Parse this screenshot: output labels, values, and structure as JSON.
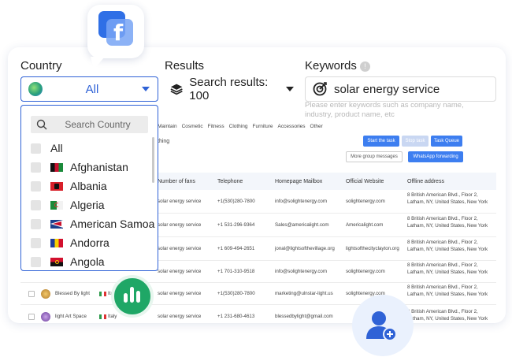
{
  "labels": {
    "country": "Country",
    "results": "Results",
    "keywords": "Keywords",
    "info": "!"
  },
  "country_select": {
    "value": "All"
  },
  "results_select": {
    "value": "Search results: 100"
  },
  "keywords_input": {
    "value": "solar energy service",
    "hint": "Please enter keywords such as company name, industry, product name, etc"
  },
  "categories": [
    "Maintain",
    "Cosmetic",
    "Fitness",
    "Clothing",
    "Furniture",
    "Accessories",
    "Other"
  ],
  "partial_label": "thing",
  "buttons": {
    "start_task": "Start the task",
    "stop_task": "Stop task",
    "task_queue": "Task Queue",
    "group_messages": "More group messages",
    "whatsapp": "WhatsApp forwarding"
  },
  "table": {
    "headers": [
      "Number of fans",
      "Telephone",
      "Homepage Mailbox",
      "Official Website",
      "Offline address"
    ],
    "rows": [
      {
        "fans": "solar energy service",
        "phone": "+1(530)280-7800",
        "mail": "info@solightenergy.com",
        "site": "solightenergy.com",
        "address": "8 British American Blvd., Floor 2, Latham, NY, United States, New York"
      },
      {
        "fans": "solar energy service",
        "phone": "+1 531-296-9364",
        "mail": "Sales@americalight.com",
        "site": "Americalight.com",
        "address": "8 British American Blvd., Floor 2, Latham, NY, United States, New York"
      },
      {
        "fans": "solar energy service",
        "phone": "+1 609-494-2651",
        "mail": "jonal@lightsofthevillage.org",
        "site": "lightsofthecityclayton.org",
        "address": "8 British American Blvd., Floor 2, Latham, NY, United States, New York"
      },
      {
        "fans": "solar energy service",
        "phone": "+1 701-310-9518",
        "mail": "info@solightenergy.com",
        "site": "solightenergy.com",
        "address": "8 British American Blvd., Floor 2, Latham, NY, United States, New York"
      },
      {
        "name": "Blessed By light",
        "country": "Italy",
        "fans": "solar energy service",
        "phone": "+1(530)280-7800",
        "mail": "marketing@ulnstar-light.us",
        "site": "solightenergy.com",
        "address": "8 British American Blvd., Floor 2, Latham, NY, United States, New York"
      },
      {
        "name": "light Art Space",
        "country": "Italy",
        "fans": "solar energy service",
        "phone": "+1 231-680-4613",
        "mail": "blessedbylight@gmail.com",
        "site": "",
        "address": "8 British American Blvd., Floor 2, Latham, NY, United States, New York"
      }
    ]
  },
  "dropdown": {
    "search_placeholder": "Search Country",
    "items": [
      "All",
      "Afghanistan",
      "Albania",
      "Algeria",
      "American Samoa",
      "Andorra",
      "Angola"
    ]
  },
  "icons": {
    "facebook": "facebook-icon",
    "globe": "globe-icon",
    "layers": "layers-icon",
    "target": "target-icon",
    "search": "search-icon",
    "chart": "bar-chart-icon",
    "add_user": "add-user-icon"
  },
  "colors": {
    "accent": "#2f62d6",
    "button": "#3d7ef0",
    "facebook": "#2f6fe6",
    "chart_badge": "#1fa766"
  }
}
